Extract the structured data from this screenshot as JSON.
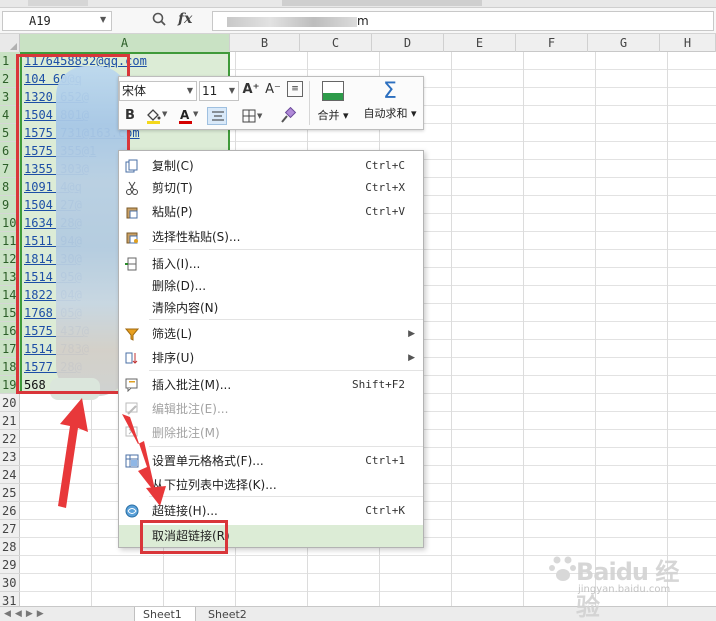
{
  "formula_bar": {
    "name_box": "A19",
    "fx_label": "fx",
    "formula_value_suffix": "m"
  },
  "columns": [
    "A",
    "B",
    "C",
    "D",
    "E",
    "F",
    "G",
    "H"
  ],
  "rows": [
    "1",
    "2",
    "3",
    "4",
    "5",
    "6",
    "7",
    "8",
    "9",
    "10",
    "11",
    "12",
    "13",
    "14",
    "15",
    "16",
    "17",
    "18",
    "19",
    "20",
    "21",
    "22",
    "23",
    "24",
    "25",
    "26",
    "27",
    "28",
    "29",
    "30",
    "31"
  ],
  "emails": [
    "1176458832@qq.com",
    "104     60@q",
    "1320     652@",
    "1504     801@",
    "1575     731@163.com",
    "1575     355@1",
    "1355     303@",
    "1091     4@q",
    "1504     27@",
    "1634     28@",
    "1511     94@",
    "1814     30@",
    "1514     95@",
    "1822     04@",
    "1768     05@",
    "1575     437@",
    "1514     783@",
    "1577     28@",
    "568     @16"
  ],
  "mini_toolbar": {
    "font_name": "宋体",
    "font_size": "11",
    "grow_font": "A⁺",
    "shrink_font": "A⁻",
    "bold": "B",
    "fill_color": "#f4d81c",
    "font_color": "#d40000",
    "merge_label": "合并",
    "autosum_label": "自动求和"
  },
  "context_menu": {
    "items": [
      {
        "label": "复制(C)",
        "shortcut": "Ctrl+C",
        "icon": "copy-icon",
        "disabled": false
      },
      {
        "label": "剪切(T)",
        "shortcut": "Ctrl+X",
        "icon": "scissors-icon",
        "disabled": false
      },
      {
        "label": "粘贴(P)",
        "shortcut": "Ctrl+V",
        "icon": "paste-icon",
        "disabled": false
      },
      {
        "label": "选择性粘贴(S)...",
        "shortcut": "",
        "icon": "paste-special-icon",
        "disabled": false
      },
      {
        "label": "插入(I)...",
        "shortcut": "",
        "icon": "insert-icon",
        "disabled": false
      },
      {
        "label": "删除(D)...",
        "shortcut": "",
        "icon": "",
        "disabled": false
      },
      {
        "label": "清除内容(N)",
        "shortcut": "",
        "icon": "",
        "disabled": false
      },
      {
        "label": "筛选(L)",
        "shortcut": "",
        "icon": "filter-icon",
        "disabled": false,
        "submenu": true
      },
      {
        "label": "排序(U)",
        "shortcut": "",
        "icon": "sort-icon",
        "disabled": false,
        "submenu": true
      },
      {
        "label": "插入批注(M)...",
        "shortcut": "Shift+F2",
        "icon": "insert-comment-icon",
        "disabled": false
      },
      {
        "label": "编辑批注(E)...",
        "shortcut": "",
        "icon": "edit-comment-icon",
        "disabled": true
      },
      {
        "label": "删除批注(M)",
        "shortcut": "",
        "icon": "delete-comment-icon",
        "disabled": true
      },
      {
        "label": "设置单元格格式(F)...",
        "shortcut": "Ctrl+1",
        "icon": "format-cells-icon",
        "disabled": false
      },
      {
        "label": "从下拉列表中选择(K)...",
        "shortcut": "",
        "icon": "",
        "disabled": false
      },
      {
        "label": "超链接(H)...",
        "shortcut": "Ctrl+K",
        "icon": "hyperlink-icon",
        "disabled": false
      },
      {
        "label": "取消超链接(R)",
        "shortcut": "",
        "icon": "",
        "disabled": false
      }
    ]
  },
  "sheet_tabs": [
    "Sheet1",
    "Sheet2"
  ],
  "watermark": {
    "text": "Baidu 经验",
    "url": "jingyan.baidu.com"
  }
}
